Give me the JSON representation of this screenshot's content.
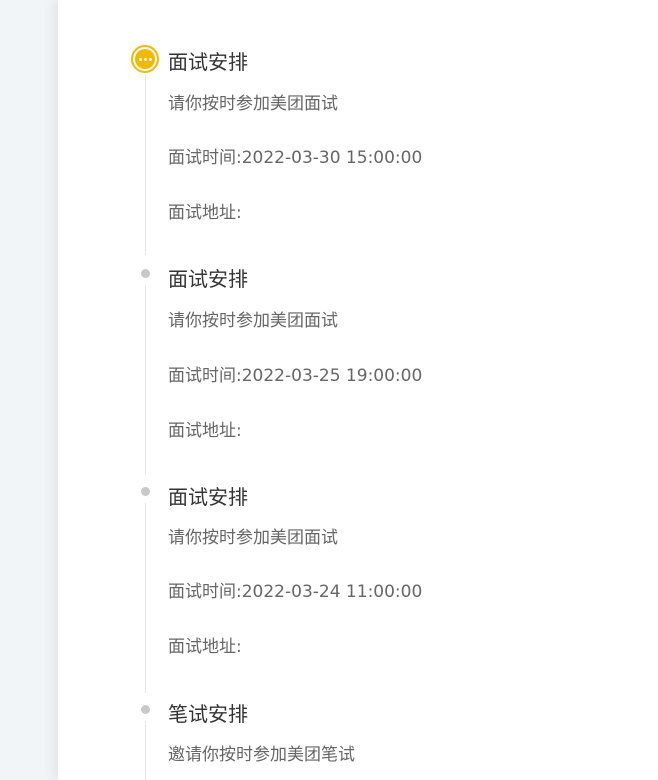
{
  "colors": {
    "accent": "#f5b800",
    "dot_inactive": "#c8c8c8",
    "line": "#e6e6e6",
    "title": "#333333",
    "text": "#666666"
  },
  "timeline": {
    "items": [
      {
        "title": "面试安排",
        "desc": "请你按时参加美团面试",
        "time_label": "面试时间:",
        "time_value": "2022-03-30 15:00:00",
        "addr_label": "面试地址:",
        "addr_value": "",
        "status": "active"
      },
      {
        "title": "面试安排",
        "desc": "请你按时参加美团面试",
        "time_label": "面试时间:",
        "time_value": "2022-03-25 19:00:00",
        "addr_label": "面试地址:",
        "addr_value": "",
        "status": "done"
      },
      {
        "title": "面试安排",
        "desc": "请你按时参加美团面试",
        "time_label": "面试时间:",
        "time_value": "2022-03-24 11:00:00",
        "addr_label": "面试地址:",
        "addr_value": "",
        "status": "done"
      },
      {
        "title": "笔试安排",
        "desc": "邀请你按时参加美团笔试",
        "status": "done"
      }
    ]
  }
}
